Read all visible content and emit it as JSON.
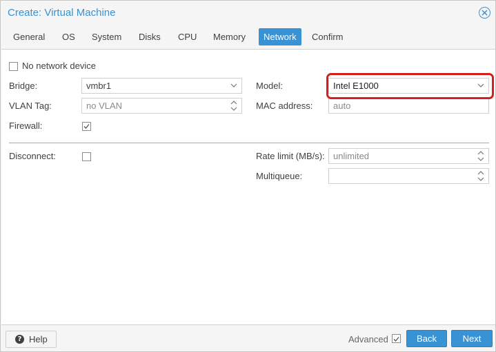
{
  "window": {
    "title": "Create: Virtual Machine"
  },
  "tabs": [
    {
      "label": "General"
    },
    {
      "label": "OS"
    },
    {
      "label": "System"
    },
    {
      "label": "Disks"
    },
    {
      "label": "CPU"
    },
    {
      "label": "Memory"
    },
    {
      "label": "Network",
      "active": true
    },
    {
      "label": "Confirm"
    }
  ],
  "form": {
    "no_network_device": {
      "label": "No network device",
      "checked": false
    },
    "bridge": {
      "label": "Bridge:",
      "value": "vmbr1"
    },
    "vlan_tag": {
      "label": "VLAN Tag:",
      "value": "no VLAN"
    },
    "firewall": {
      "label": "Firewall:",
      "checked": true
    },
    "model": {
      "label": "Model:",
      "value": "Intel E1000"
    },
    "mac_address": {
      "label": "MAC address:",
      "value": "auto"
    },
    "disconnect": {
      "label": "Disconnect:",
      "checked": false
    },
    "rate_limit": {
      "label": "Rate limit (MB/s):",
      "value": "unlimited"
    },
    "multiqueue": {
      "label": "Multiqueue:",
      "value": ""
    }
  },
  "footer": {
    "help_label": "Help",
    "advanced_label": "Advanced",
    "advanced_checked": true,
    "back_label": "Back",
    "next_label": "Next"
  },
  "colors": {
    "accent": "#3892d4",
    "highlight": "#d4201d"
  }
}
